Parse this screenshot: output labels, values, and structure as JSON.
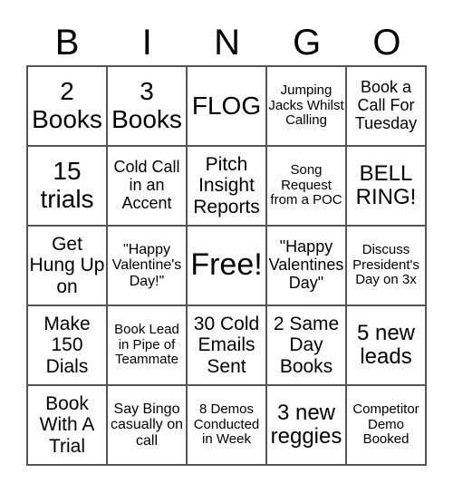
{
  "header": [
    "B",
    "I",
    "N",
    "G",
    "O"
  ],
  "cells": [
    [
      "2 Books",
      "3 Books",
      "FLOG",
      "Jumping Jacks Whilst Calling",
      "Book a Call For Tuesday"
    ],
    [
      "15 trials",
      "Cold Call in an Accent",
      "Pitch Insight Reports",
      "Song Request from a POC",
      "BELL RING!"
    ],
    [
      "Get Hung Up on",
      "\"Happy Valentine's Day!\"",
      "Free!",
      "\"Happy Valentines Day\"",
      "Discuss President's Day on 3x"
    ],
    [
      "Make 150 Dials",
      "Book Lead in Pipe of Teammate",
      "30 Cold Emails Sent",
      "2 Same Day Books",
      "5 new leads"
    ],
    [
      "Book With A Trial",
      "Say Bingo casually on call",
      "8 Demos Conducted in Week",
      "3 new reggies",
      "Competitor Demo Booked"
    ]
  ]
}
